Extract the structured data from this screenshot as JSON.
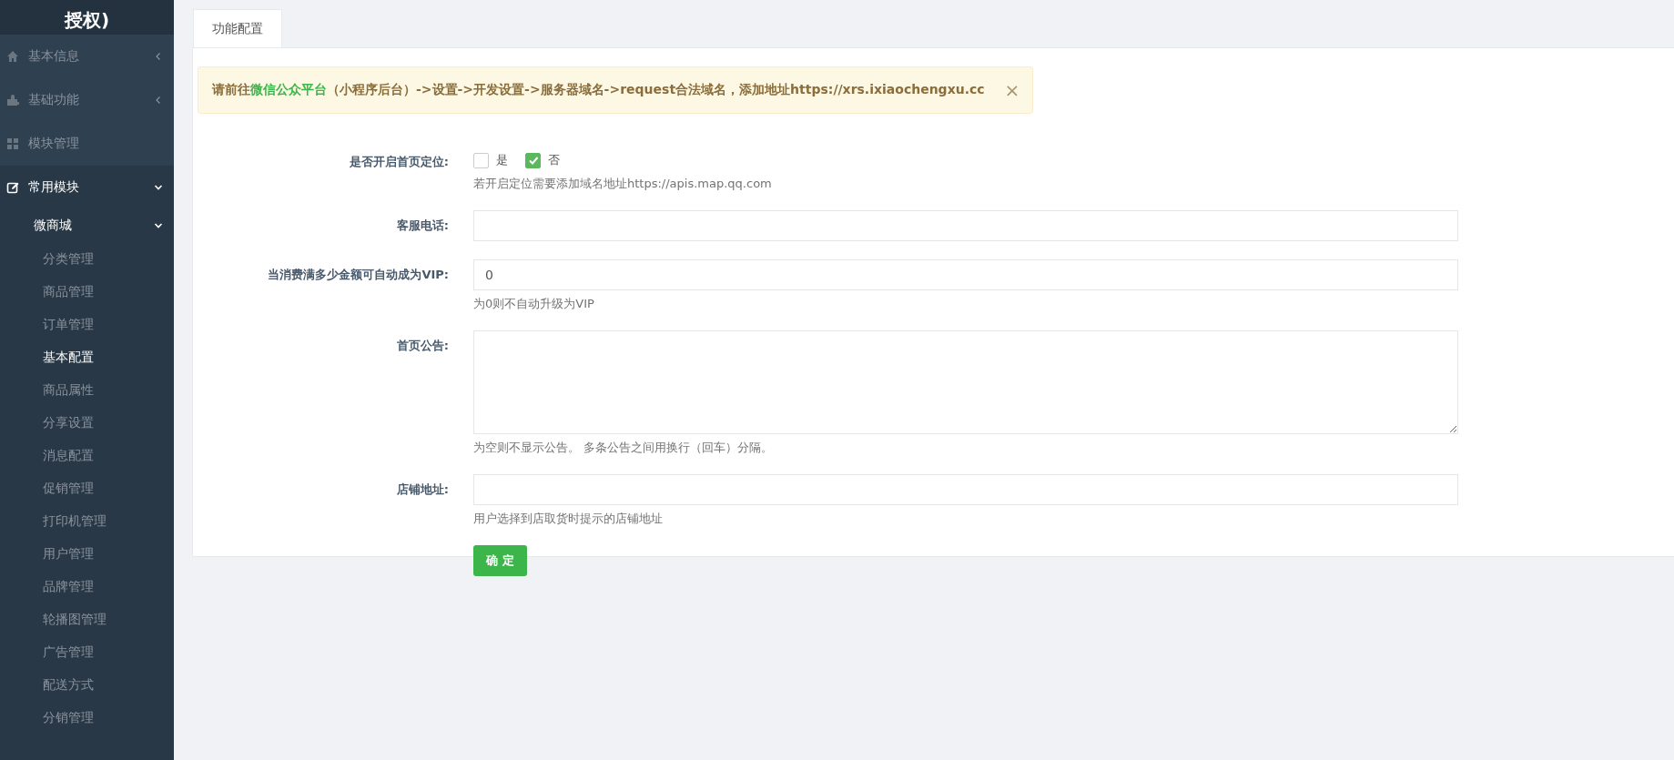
{
  "logo": {
    "text": "授权)"
  },
  "sidebar": {
    "items": [
      {
        "label": "基本信息",
        "expanded": false
      },
      {
        "label": "基础功能",
        "expanded": false
      },
      {
        "label": "模块管理"
      },
      {
        "label": "常用模块",
        "expanded": true,
        "children": [
          {
            "label": "微商城",
            "expanded": true,
            "children": [
              {
                "label": "分类管理",
                "selected": false
              },
              {
                "label": "商品管理",
                "selected": false
              },
              {
                "label": "订单管理",
                "selected": false
              },
              {
                "label": "基本配置",
                "selected": true
              },
              {
                "label": "商品属性",
                "selected": false
              },
              {
                "label": "分享设置",
                "selected": false
              },
              {
                "label": "消息配置",
                "selected": false
              },
              {
                "label": "促销管理",
                "selected": false
              },
              {
                "label": "打印机管理",
                "selected": false
              },
              {
                "label": "用户管理",
                "selected": false
              },
              {
                "label": "品牌管理",
                "selected": false
              },
              {
                "label": "轮播图管理",
                "selected": false
              },
              {
                "label": "广告管理",
                "selected": false
              },
              {
                "label": "配送方式",
                "selected": false
              },
              {
                "label": "分销管理",
                "selected": false
              }
            ]
          }
        ]
      }
    ]
  },
  "tabs": [
    {
      "label": "功能配置",
      "selected": true
    }
  ],
  "alert": {
    "prefix": "请前往",
    "link": "微信公众平台",
    "suffix": "（小程序后台）->设置->开发设置->服务器域名->request合法域名，添加地址https://xrs.ixiaochengxu.cc",
    "close": "×"
  },
  "form": {
    "fields": [
      {
        "kind": "checks",
        "label": "是否开启首页定位:",
        "options": [
          {
            "label": "是",
            "checked": false
          },
          {
            "label": "否",
            "checked": true
          }
        ],
        "help": "若开启定位需要添加域名地址https://apis.map.qq.com"
      },
      {
        "kind": "input",
        "label": "客服电话:"
      },
      {
        "kind": "input",
        "label": "当消费满多少金额可自动成为VIP:",
        "value": "0",
        "help": "为0则不自动升级为VIP"
      },
      {
        "kind": "textarea",
        "label": "首页公告:",
        "help": "为空则不显示公告。 多条公告之间用换行（回车）分隔。"
      },
      {
        "kind": "input",
        "label": "店铺地址:",
        "help": "用户选择到店取货时提示的店铺地址"
      }
    ],
    "submit": "确 定"
  }
}
